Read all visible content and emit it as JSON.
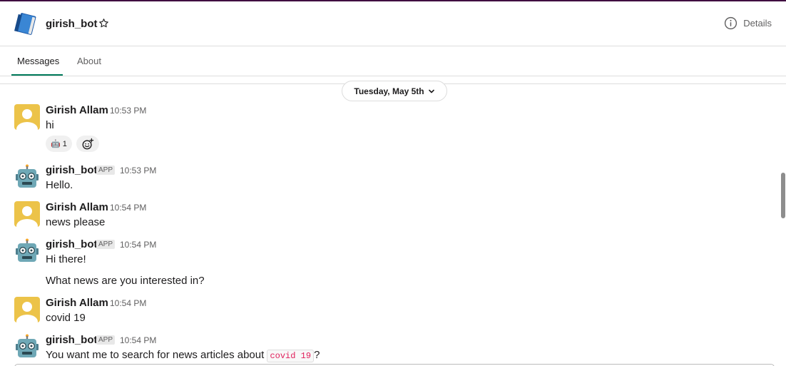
{
  "header": {
    "title": "girish_bot",
    "details_label": "Details",
    "icon": "book-icon",
    "star_icon": "star-outline-icon",
    "details_icon": "info-circle-icon"
  },
  "tabs": [
    {
      "label": "Messages",
      "active": true
    },
    {
      "label": "About",
      "active": false
    }
  ],
  "date_divider": {
    "label": "Tuesday, May 5th",
    "icon": "chevron-down-icon"
  },
  "messages": [
    {
      "sender": "Girish Allam",
      "time": "10:53 PM",
      "text": "hi",
      "avatar": "user-avatar-yellow"
    },
    {
      "sender": "girish_bot",
      "badge": "APP",
      "time": "10:53 PM",
      "text": "Hello.",
      "avatar": "robot-avatar"
    },
    {
      "sender": "Girish Allam",
      "time": "10:54 PM",
      "text": "news please",
      "avatar": "user-avatar-yellow"
    },
    {
      "sender": "girish_bot",
      "badge": "APP",
      "time": "10:54 PM",
      "text": "Hi there!",
      "text2": "What news are you interested in?",
      "avatar": "robot-avatar"
    },
    {
      "sender": "Girish Allam",
      "time": "10:54 PM",
      "text": "covid 19",
      "avatar": "user-avatar-yellow"
    },
    {
      "sender": "girish_bot",
      "badge": "APP",
      "time": "10:54 PM",
      "text_before": "You want me to search for news articles about ",
      "code": "covid 19",
      "text_after": "?",
      "avatar": "robot-avatar"
    }
  ],
  "reaction": {
    "emoji": "🤖",
    "count": "1",
    "icon": "robot-emoji-icon",
    "add_icon": "add-emoji-icon"
  },
  "colors": {
    "accent": "#007a5a",
    "top_bar": "#3f0e40",
    "user_avatar": "#ecc349",
    "code_text": "#e01e5a"
  }
}
